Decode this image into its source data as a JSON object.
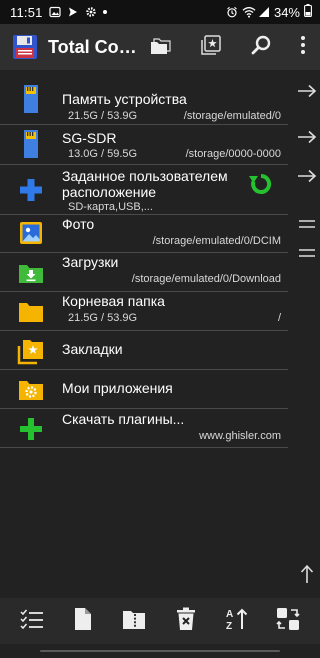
{
  "status_bar": {
    "time": "11:51",
    "battery": "34%",
    "icons_left": [
      "gallery-icon",
      "messenger-icon",
      "settings-icon",
      "dot-icon"
    ],
    "icons_right": [
      "alarm-icon",
      "wifi-icon",
      "signal-icon",
      "battery-icon"
    ]
  },
  "app_bar": {
    "title": "Total Co…",
    "actions": [
      "folders-icon",
      "bookmark-icon",
      "search-icon",
      "overflow-menu-icon"
    ]
  },
  "entries": [
    {
      "name": "Память устройства",
      "size": "21.5G / 53.9G",
      "path": "/storage/emulated/0",
      "icon": "sd-card-icon"
    },
    {
      "name": "SG-SDR",
      "size": "13.0G / 59.5G",
      "path": "/storage/0000-0000",
      "icon": "sd-card-icon"
    },
    {
      "name": "Заданное пользователем расположение",
      "name_line1": "Заданное пользователем",
      "name_line2": "расположение",
      "size": "SD-карта,USB,...",
      "icon": "plus-blue-icon",
      "action_icon": "refresh-green-icon"
    },
    {
      "name": "Фото",
      "path": "/storage/emulated/0/DCIM",
      "icon": "photo-folder-icon"
    },
    {
      "name": "Загрузки",
      "path": "/storage/emulated/0/Download",
      "icon": "downloads-folder-icon"
    },
    {
      "name": "Корневая папка",
      "size": "21.5G / 53.9G",
      "path": "/",
      "icon": "root-folder-icon"
    },
    {
      "name": "Закладки",
      "icon": "bookmarks-folder-icon"
    },
    {
      "name": "Мои приложения",
      "icon": "apps-folder-icon"
    },
    {
      "name": "Скачать плагины...",
      "path": "www.ghisler.com",
      "icon": "plus-green-icon"
    }
  ],
  "side_buttons": [
    "arrow-right-icon",
    "arrow-right-icon",
    "arrow-right-icon",
    "equals-icon",
    "equals-icon",
    "arrow-up-icon"
  ],
  "bottom_toolbar": [
    "select-list-icon",
    "new-file-icon",
    "archive-icon",
    "delete-icon",
    "sort-icon",
    "swap-panels-icon"
  ],
  "colors": {
    "background": "#222222",
    "app_bar": "#2f2f2f",
    "folder_yellow": "#f5b400",
    "sd_blue": "#3f7fe0",
    "green": "#25c12f",
    "blue_plus": "#2f7ae8"
  }
}
